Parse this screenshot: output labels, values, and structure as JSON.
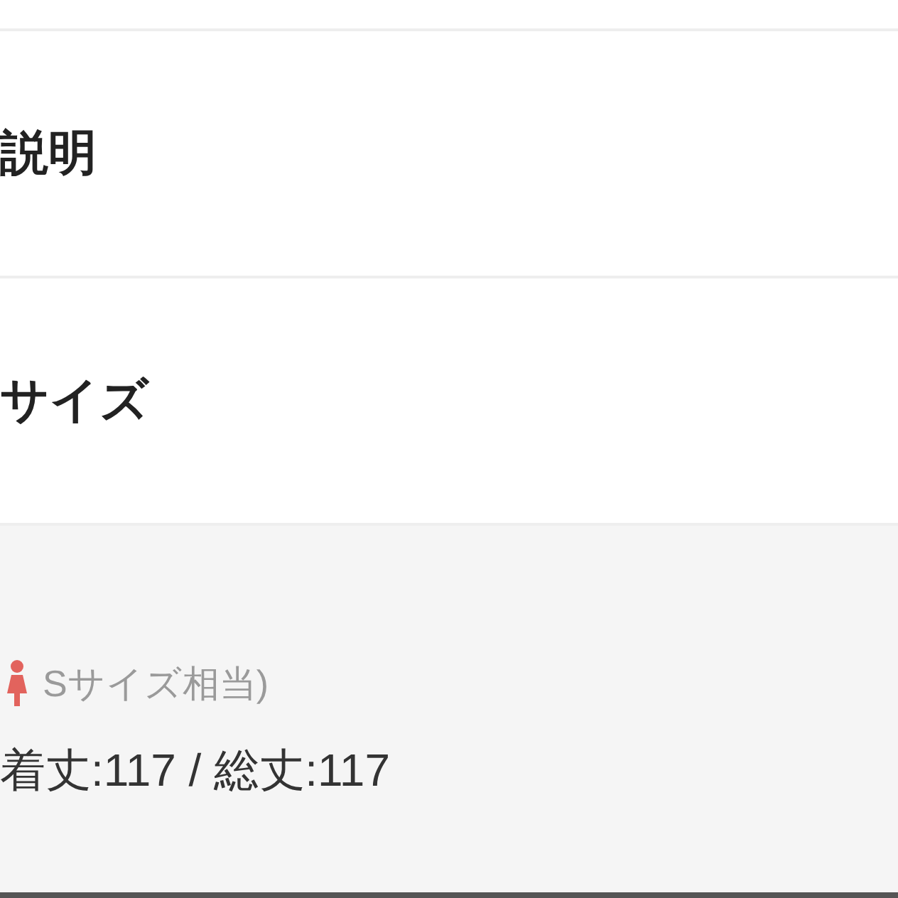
{
  "sections": [
    {
      "title": "説明"
    },
    {
      "title": "サイズ"
    }
  ],
  "size_panel": {
    "note": "Sサイズ相当)",
    "measurements": "着丈:117 / 総丈:117"
  }
}
